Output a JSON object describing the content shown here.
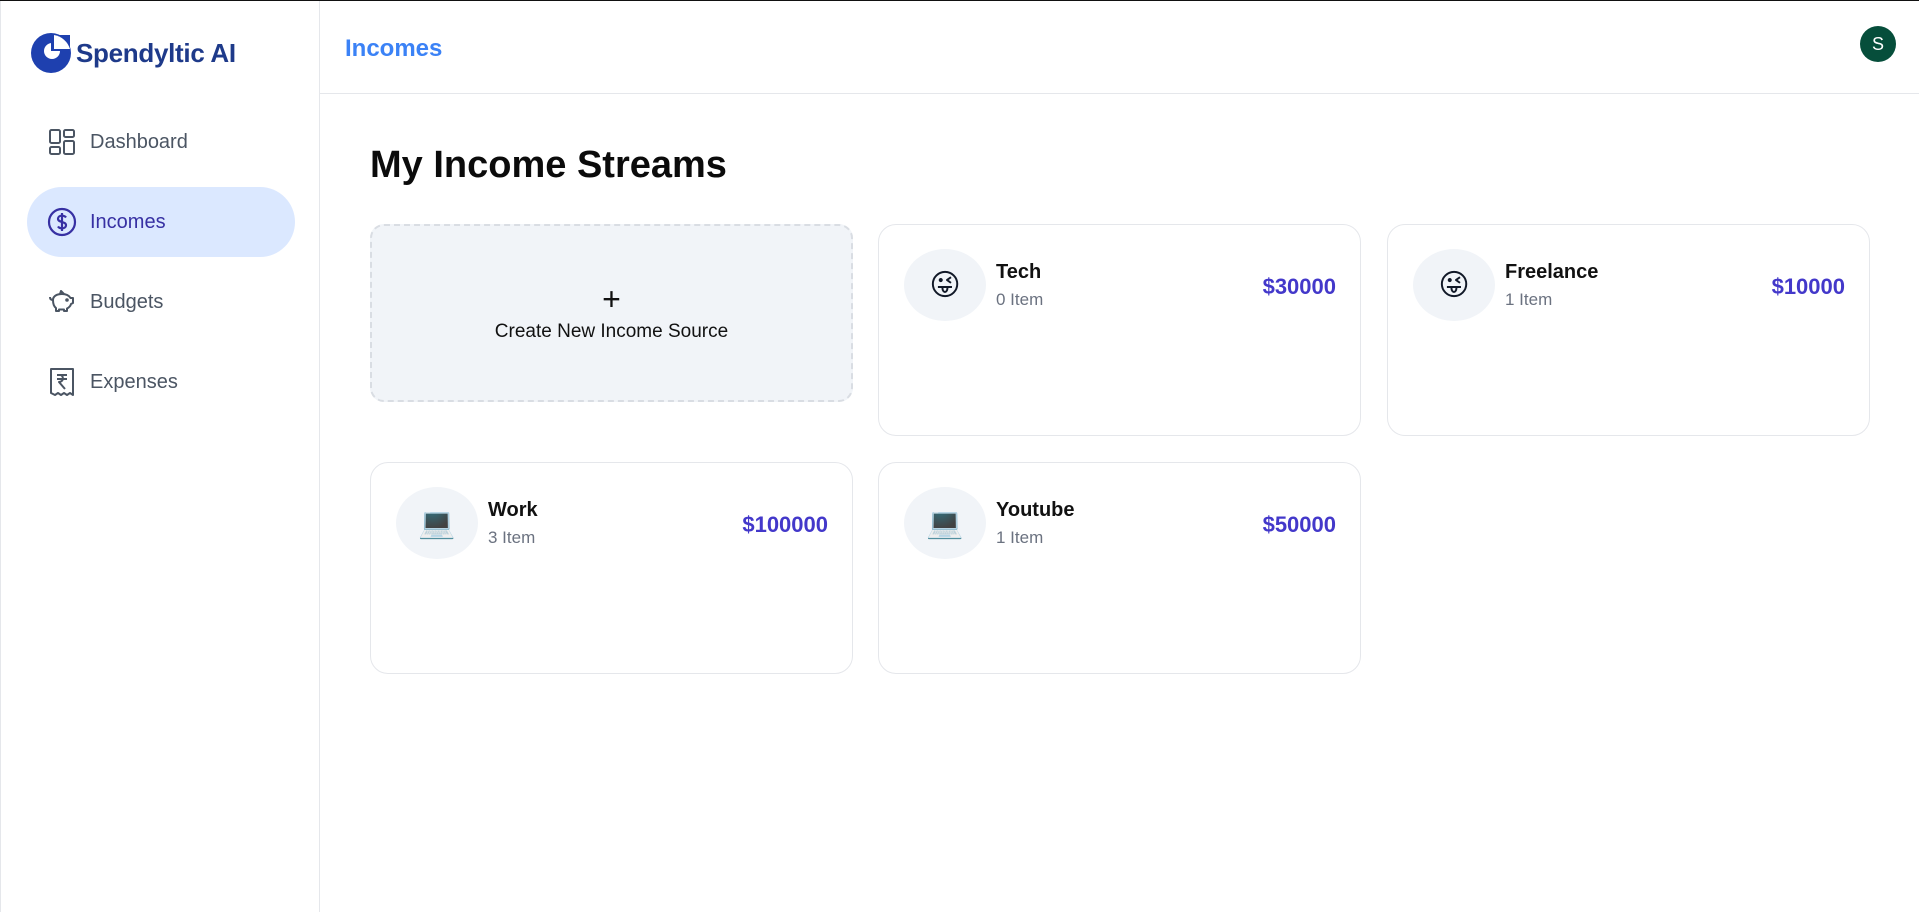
{
  "app": {
    "name": "Spendyltic AI"
  },
  "sidebar": {
    "items": [
      {
        "label": "Dashboard",
        "icon": "dashboard-icon"
      },
      {
        "label": "Incomes",
        "icon": "dollar-circle-icon",
        "active": true
      },
      {
        "label": "Budgets",
        "icon": "piggy-bank-icon"
      },
      {
        "label": "Expenses",
        "icon": "receipt-icon"
      }
    ]
  },
  "header": {
    "title": "Incomes",
    "avatar_initial": "S"
  },
  "main": {
    "title": "My Income Streams",
    "create": {
      "plus": "+",
      "label": "Create New Income Source"
    },
    "incomes": [
      {
        "emoji": "😜",
        "name": "Tech",
        "count": "0 Item",
        "amount": "$30000"
      },
      {
        "emoji": "😜",
        "name": "Freelance",
        "count": "1 Item",
        "amount": "$10000"
      },
      {
        "emoji": "💻",
        "name": "Work",
        "count": "3 Item",
        "amount": "$100000"
      },
      {
        "emoji": "💻",
        "name": "Youtube",
        "count": "1 Item",
        "amount": "$50000"
      }
    ]
  },
  "colors": {
    "accent": "#3b82f6",
    "brand": "#1e3a8a",
    "amount": "#4338ca",
    "active_nav": "#dbe8ff",
    "avatar": "#064e3b"
  }
}
